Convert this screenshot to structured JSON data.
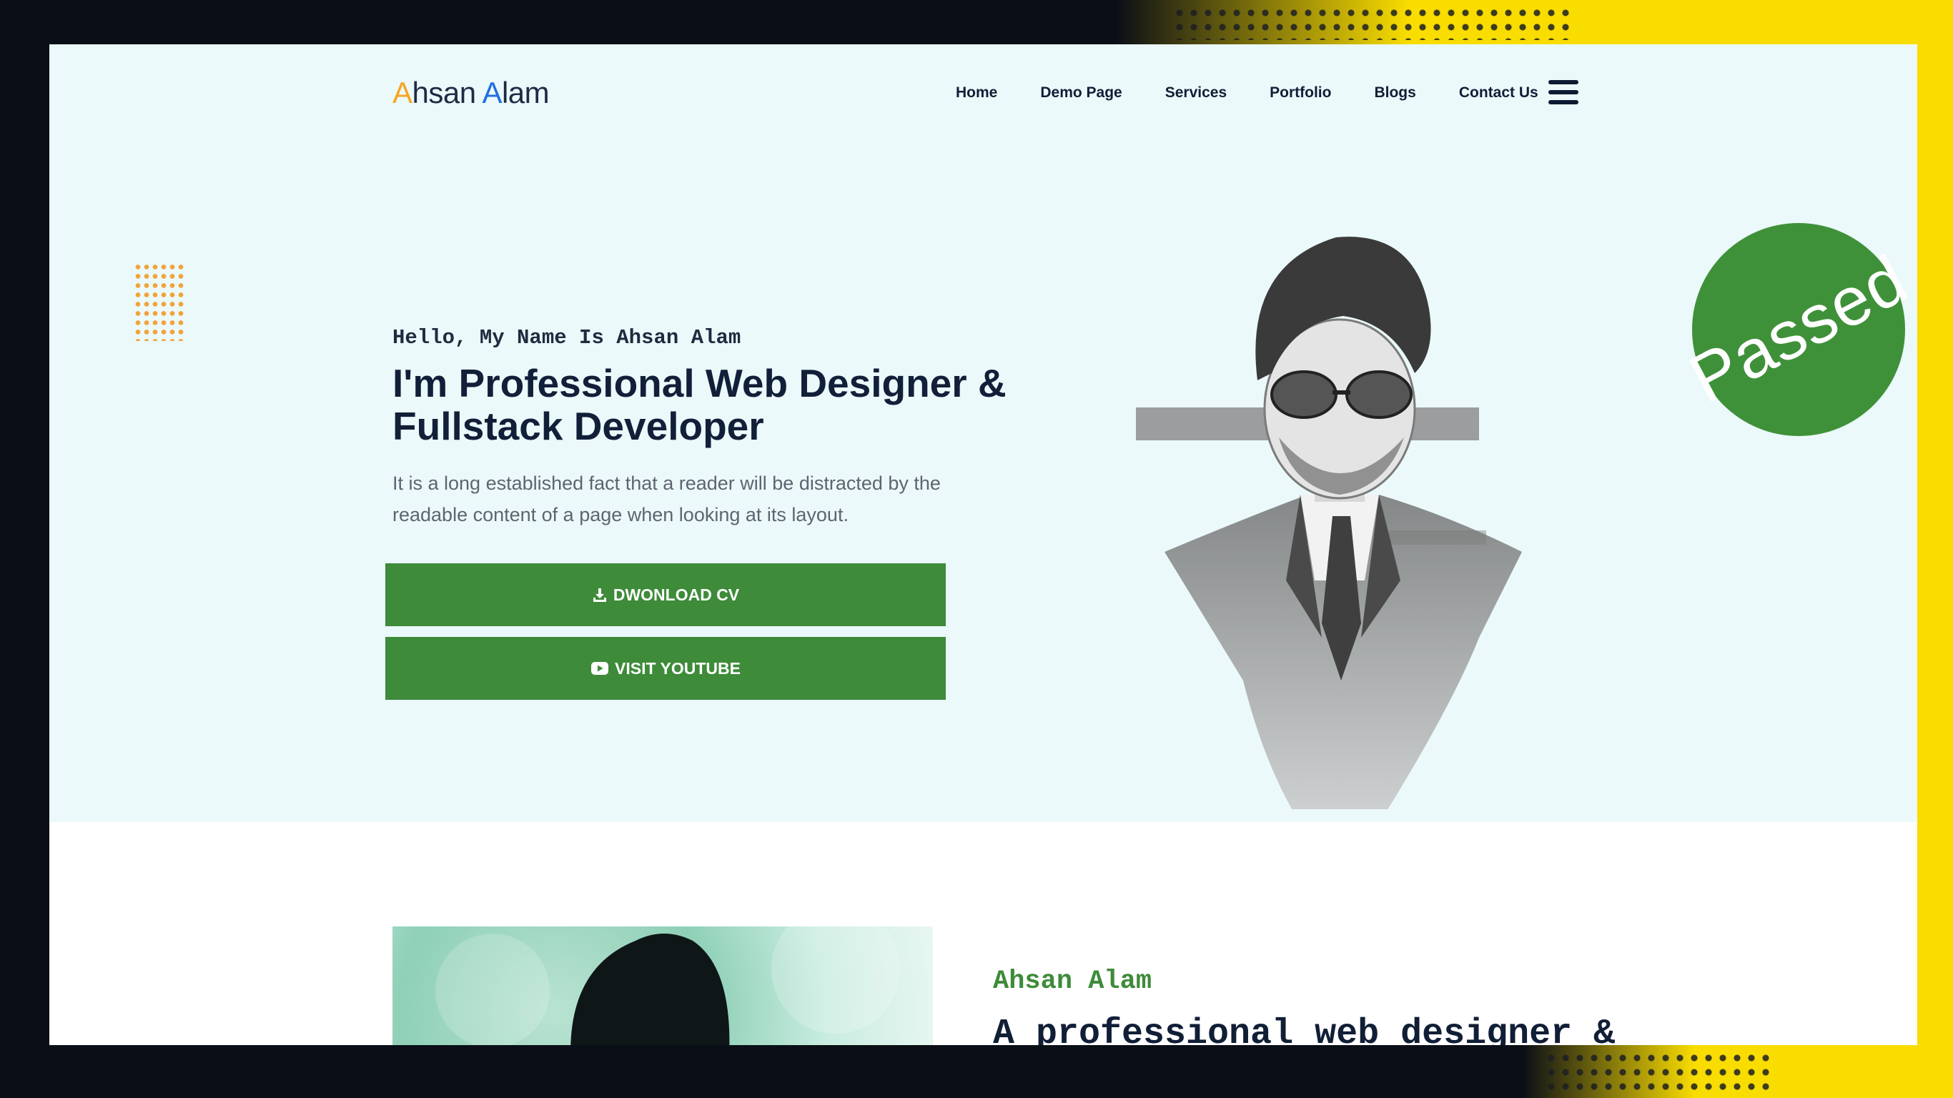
{
  "header": {
    "logo_first_letter": "A",
    "logo_first_rest": "hsan",
    "logo_second_letter": "A",
    "logo_second_rest": "lam",
    "nav": [
      "Home",
      "Demo Page",
      "Services",
      "Portfolio",
      "Blogs",
      "Contact Us"
    ],
    "menu_icon": "hamburger-menu-icon"
  },
  "hero": {
    "greeting": "Hello, My Name Is Ahsan Alam",
    "headline_line1": "I'm Professional Web Designer &",
    "headline_line2": "Fullstack Developer",
    "lead": "It is a long established fact that a reader will be distracted by the readable content of a page when looking at its layout.",
    "download_label": "DWONLOAD CV",
    "download_icon": "download-icon",
    "youtube_label": "VISIT YOUTUBE",
    "youtube_icon": "youtube-icon"
  },
  "stamp": {
    "text": "Passed"
  },
  "about": {
    "name": "Ahsan Alam",
    "title": "A professional web designer &"
  },
  "colors": {
    "accent_green": "#3e8b3a",
    "logo_orange": "#f6a623",
    "logo_blue": "#1f6fe0",
    "hero_background": "#ebf9fa",
    "frame_yellow": "#f9dc00",
    "frame_dark": "#0a0e16"
  }
}
